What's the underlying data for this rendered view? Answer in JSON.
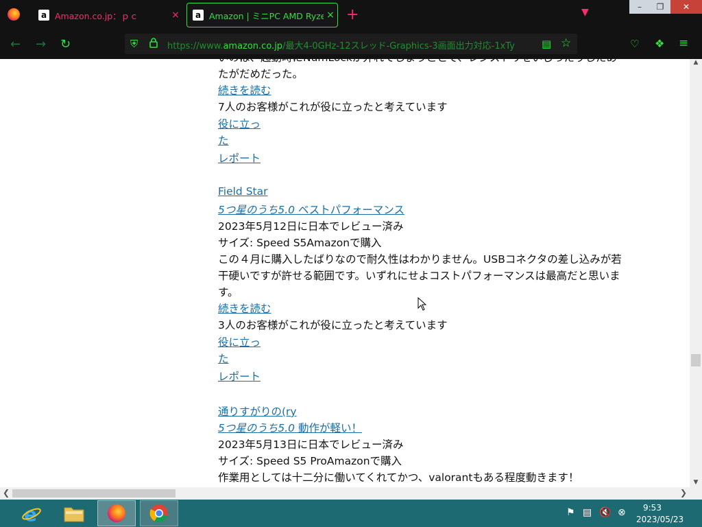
{
  "browser": {
    "tabs": [
      {
        "favicon": "a",
        "title": "Amazon.co.jp：ｐｃ",
        "close": "×"
      },
      {
        "favicon": "a",
        "title": "Amazon | ミニPC AMD Ryzen",
        "close": "×"
      }
    ],
    "new_tab": "+",
    "url_prefix": "https://www.",
    "url_domain": "amazon.co.jp",
    "url_rest": "/最大4-0GHz-12スレッド-Graphics-3画面出力対応-1xTy",
    "window_controls": {
      "minimize": "–",
      "maximize": "❐",
      "close": "✕"
    }
  },
  "page": {
    "partial_line": "いのは、起動時にNumLockが外れてしまうことで、レジストリをいじったりしたあ",
    "review1": {
      "tail": "たがだめだった。",
      "read_more": "続きを読む",
      "helpful_count": "7人のお客様がこれが役に立ったと考えています",
      "helpful_1": "役に立っ",
      "helpful_2": "た",
      "report": "レポート"
    },
    "review2": {
      "author": "Field Star",
      "rating_title_stars": "5つ星のうち5.0",
      "rating_title_text": " ベストパフォーマンス",
      "date": "2023年5月12日に日本でレビュー済み",
      "size": "サイズ: Speed S5Amazonで購入",
      "body_1": "この４月に購入したばりなので耐久性はわかりません。USBコネクタの差し込みが若",
      "body_2": "干硬いですが許せる範囲です。いずれにせよコストパフォーマンスは最高だと思いま",
      "body_3": "す。",
      "read_more": "続きを読む",
      "helpful_count": "3人のお客様がこれが役に立ったと考えています",
      "helpful_1": "役に立っ",
      "helpful_2": "た",
      "report": "レポート"
    },
    "review3": {
      "author": "通りすがりの(ry",
      "rating_title_stars": "5つ星のうち5.0",
      "rating_title_text": " 動作が軽い！",
      "date": "2023年5月13日に日本でレビュー済み",
      "size": "サイズ: Speed S5 ProAmazonで購入",
      "body_1": "作業用としては十二分に働いてくれてかつ、valorantもある程度動きます！"
    }
  },
  "taskbar": {
    "time": "9:53",
    "date": "2023/05/23"
  },
  "colors": {
    "accent_green": "#2fe040",
    "accent_pink": "#ff2a6d",
    "link": "#1a6ea8",
    "taskbar": "#1d6a73"
  },
  "icons": [
    "firefox-logo-icon",
    "amazon-favicon",
    "close-icon",
    "plus-icon",
    "chevron-down-icon",
    "back-arrow-icon",
    "forward-arrow-icon",
    "reload-icon",
    "shield-icon",
    "lock-icon",
    "reader-view-icon",
    "star-bookmark-icon",
    "pocket-icon",
    "extensions-icon",
    "hamburger-menu-icon",
    "internet-explorer-icon",
    "file-explorer-icon",
    "firefox-icon",
    "chrome-icon",
    "flag-icon",
    "network-icon",
    "speaker-muted-icon",
    "cancel-circle-icon"
  ]
}
